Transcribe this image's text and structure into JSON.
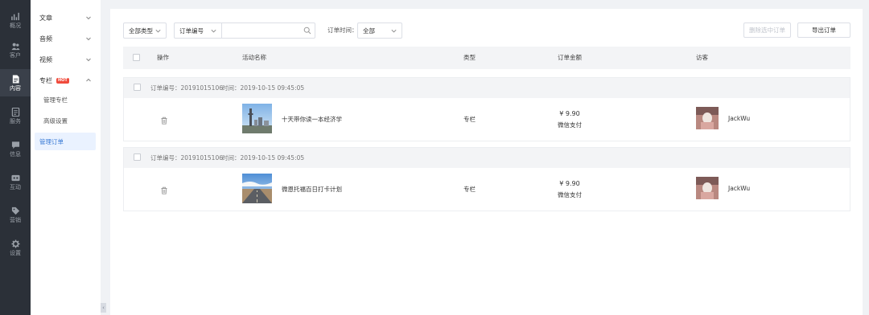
{
  "nav": [
    {
      "label": "概况",
      "icon": "chart-icon"
    },
    {
      "label": "客户",
      "icon": "users-icon"
    },
    {
      "label": "内容",
      "icon": "document-icon"
    },
    {
      "label": "服务",
      "icon": "service-icon"
    },
    {
      "label": "信息",
      "icon": "message-icon"
    },
    {
      "label": "互动",
      "icon": "interact-icon"
    },
    {
      "label": "营销",
      "icon": "tag-icon"
    },
    {
      "label": "设置",
      "icon": "gear-icon"
    }
  ],
  "submenu": {
    "article": "文章",
    "audio": "音频",
    "video": "视频",
    "column": "专栏",
    "hot_badge": "HOT",
    "manage_column": "管理专栏",
    "advanced": "高级设置",
    "manage_orders": "管理订单",
    "collapse": "‹"
  },
  "toolbar": {
    "type_filter": "全部类型",
    "order_field": "订单编号",
    "search_value": "",
    "search_placeholder": "",
    "time_label": "订单时间：",
    "time_value": "全部",
    "delete_selected": "删除选中订单",
    "export": "导出订单"
  },
  "table": {
    "columns": [
      "操作",
      "活动名称",
      "类型",
      "订单金额",
      "访客"
    ],
    "orders": [
      {
        "order_label": "订单编号：20191015106",
        "time_label": "时间：2019-10-15 09:45:05",
        "activity": "十天带你读一本经济学",
        "type": "专栏",
        "amount": "¥ 9.90",
        "payment": "微信支付",
        "visitor": "JackWu"
      },
      {
        "order_label": "订单编号：20191015106",
        "time_label": "时间：2019-10-15 09:45:05",
        "activity": "微恩托福百日打卡计划",
        "type": "专栏",
        "amount": "¥ 9.90",
        "payment": "微信支付",
        "visitor": "JackWu"
      }
    ]
  },
  "colors": {
    "nav_bg": "#2b3038",
    "accent": "#3a7bd5",
    "hot": "#f04b3c"
  }
}
